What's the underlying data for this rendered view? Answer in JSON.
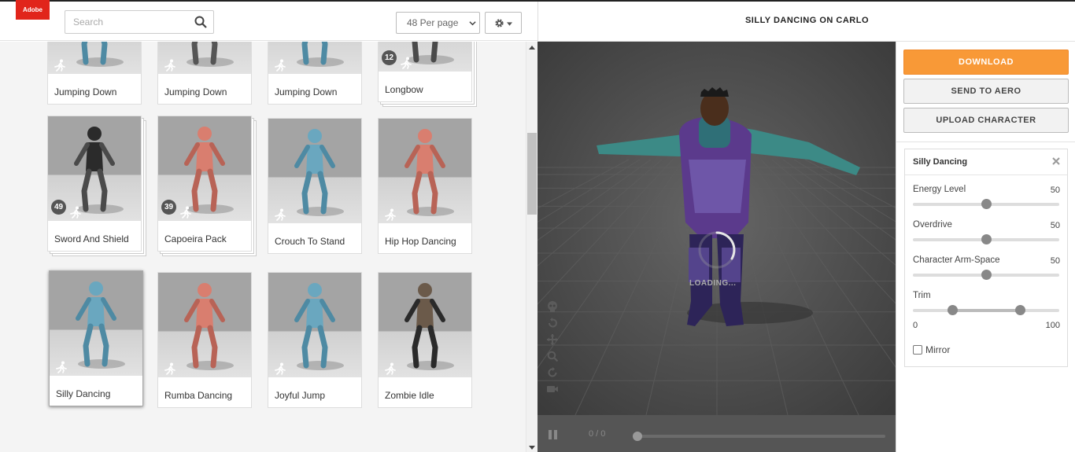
{
  "header": {
    "logo_text": "Adobe",
    "search_placeholder": "Search",
    "per_page": "48 Per page"
  },
  "grid": {
    "cards": [
      {
        "label": "Jumping Down",
        "badge": null
      },
      {
        "label": "Jumping Down",
        "badge": null
      },
      {
        "label": "Jumping Down",
        "badge": null
      },
      {
        "label": "Longbow",
        "badge": "12"
      },
      {
        "label": "Sword And Shield",
        "badge": "49"
      },
      {
        "label": "Capoeira Pack",
        "badge": "39"
      },
      {
        "label": "Crouch To Stand",
        "badge": null
      },
      {
        "label": "Hip Hop Dancing",
        "badge": null
      },
      {
        "label": "Silly Dancing",
        "badge": null,
        "selected": true
      },
      {
        "label": "Rumba Dancing",
        "badge": null
      },
      {
        "label": "Joyful Jump",
        "badge": null
      },
      {
        "label": "Zombie Idle",
        "badge": null
      }
    ]
  },
  "viewer": {
    "title": "SILLY DANCING ON CARLO",
    "loading_text": "LOADING...",
    "frame_counter": "0 / 0",
    "tools": [
      "skull-icon",
      "undo-icon",
      "move-icon",
      "zoom-icon",
      "rotate-icon",
      "camera-icon"
    ]
  },
  "panel": {
    "download_label": "DOWNLOAD",
    "aero_label": "SEND TO AERO",
    "upload_label": "UPLOAD CHARACTER",
    "accent_color": "#f89937",
    "settings": {
      "title": "Silly Dancing",
      "energy_label": "Energy Level",
      "energy_value": "50",
      "overdrive_label": "Overdrive",
      "overdrive_value": "50",
      "arm_label": "Character Arm-Space",
      "arm_value": "50",
      "trim_label": "Trim",
      "trim_min": "0",
      "trim_max": "100",
      "mirror_label": "Mirror",
      "mirror_checked": false
    }
  }
}
